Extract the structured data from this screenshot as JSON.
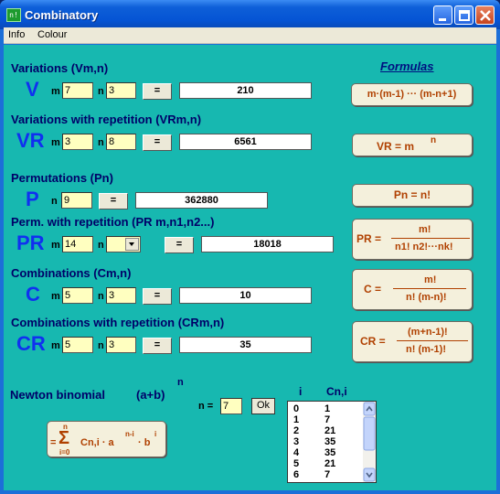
{
  "window": {
    "title": "Combinatory",
    "icon": "app-icon"
  },
  "menu": [
    "Info",
    "Colour"
  ],
  "formulas_title": "Formulas",
  "variations": {
    "label": "Variations (Vm,n)",
    "symbol": "V",
    "m_label": "m",
    "m": "7",
    "n_label": "n",
    "n": "3",
    "eq": "=",
    "result": "210",
    "formula": "m·(m-1) ··· (m-n+1)"
  },
  "variations_rep": {
    "label": "Variations with repetition (VRm,n)",
    "symbol": "VR",
    "m_label": "m",
    "m": "3",
    "n_label": "n",
    "n": "8",
    "eq": "=",
    "result": "6561",
    "formula_lhs": "VR = m",
    "formula_exp": "n"
  },
  "permutations": {
    "label": "Permutations (Pn)",
    "symbol": "P",
    "n_label": "n",
    "n": "9",
    "eq": "=",
    "result": "362880",
    "formula": "Pn = n!"
  },
  "perm_rep": {
    "label": "Perm. with repetition (PR m,n1,n2...)",
    "symbol": "PR",
    "m_label": "m",
    "m": "14",
    "n_label": "n",
    "n": "",
    "eq": "=",
    "result": "18018",
    "formula_lhs": "PR =",
    "formula_num": "m!",
    "formula_den": "n1! n2!···nk!"
  },
  "combinations": {
    "label": "Combinations (Cm,n)",
    "symbol": "C",
    "m_label": "m",
    "m": "5",
    "n_label": "n",
    "n": "3",
    "eq": "=",
    "result": "10",
    "formula_lhs": "C =",
    "formula_num": "m!",
    "formula_den": "n! (m-n)!"
  },
  "combinations_rep": {
    "label": "Combinations with repetition (CRm,n)",
    "symbol": "CR",
    "m_label": "m",
    "m": "5",
    "n_label": "n",
    "n": "3",
    "eq": "=",
    "result": "35",
    "formula_lhs": "CR =",
    "formula_num": "(m+n-1)!",
    "formula_den": "n! (m-1)!"
  },
  "newton": {
    "label": "Newton binomial",
    "expr": "(a+b)",
    "exp": "n",
    "n_label": "n =",
    "n": "7",
    "ok": "Ok",
    "col_i": "i",
    "col_cn": "Cn,i",
    "rows": [
      {
        "i": "0",
        "cn": "1"
      },
      {
        "i": "1",
        "cn": "7"
      },
      {
        "i": "2",
        "cn": "21"
      },
      {
        "i": "3",
        "cn": "35"
      },
      {
        "i": "4",
        "cn": "35"
      },
      {
        "i": "5",
        "cn": "21"
      },
      {
        "i": "6",
        "cn": "7"
      }
    ],
    "sum_top": "n",
    "sum_bottom": "i=0",
    "sum_body": "Cn,i · a",
    "sum_exp1": "n-i",
    "sum_mid": " · b",
    "sum_exp2": "i",
    "sum_eq": "="
  },
  "colors": {
    "client": "#17b8b0",
    "input": "#ffffc0",
    "formula_text": "#b04000",
    "big_symbol": "#1030f0"
  }
}
